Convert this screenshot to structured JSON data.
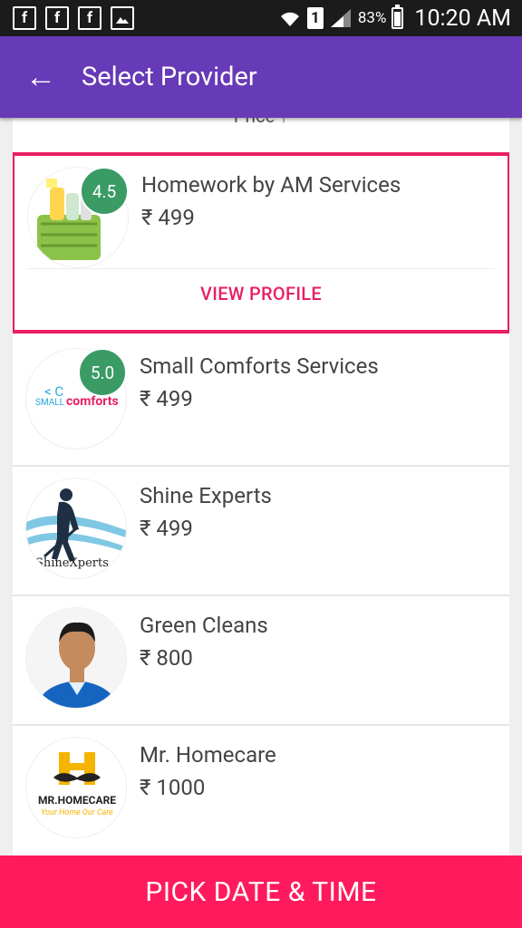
{
  "statusbar": {
    "battery_pct": "83%",
    "sim_slot": "1",
    "time": "10:20 AM"
  },
  "appbar": {
    "back_glyph": "←",
    "title": "Select Provider"
  },
  "list": {
    "partial_header": "Price",
    "partial_header_arrow": "↑",
    "view_profile_label": "VIEW PROFILE",
    "providers": [
      {
        "name": "Homework by AM Services",
        "price": "₹ 499",
        "rating": "4.5"
      },
      {
        "name": "Small Comforts Services",
        "price": "₹ 499",
        "rating": "5.0",
        "logo_text": "comforts",
        "logo_small": "SMALL",
        "logo_sc": "< C"
      },
      {
        "name": "Shine Experts",
        "price": "₹ 499",
        "logo_text": "ShineXperts"
      },
      {
        "name": "Green Cleans",
        "price": "₹ 800"
      },
      {
        "name": "Mr. Homecare",
        "price": "₹ 1000",
        "logo_text": "MR.HOMECARE",
        "logo_tag": "Your Home Our Care"
      }
    ]
  },
  "bottom_button": {
    "label": "PICK DATE & TIME"
  },
  "colors": {
    "appbar": "#673ab7",
    "accent": "#e91e63",
    "rating": "#3a9b65",
    "bottom": "#ff1a5e"
  }
}
